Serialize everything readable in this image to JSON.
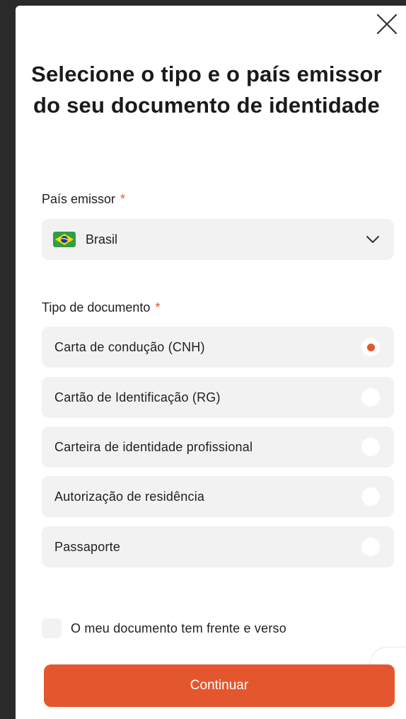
{
  "dialog": {
    "title": "Selecione o tipo e o país emissor do seu documento de identidade"
  },
  "country": {
    "label": "País emissor",
    "required_mark": "*",
    "selected_value": "Brasil",
    "flag_icon": "brazil-flag-icon"
  },
  "document_type": {
    "label": "Tipo de documento",
    "required_mark": "*",
    "options": [
      {
        "label": "Carta de condução (CNH)",
        "selected": true
      },
      {
        "label": "Cartão de Identificação (RG)",
        "selected": false
      },
      {
        "label": "Carteira de identidade profissional",
        "selected": false
      },
      {
        "label": "Autorização de residência",
        "selected": false
      },
      {
        "label": "Passaporte",
        "selected": false
      }
    ]
  },
  "two_sided": {
    "label": "O meu documento tem frente e verso",
    "checked": false
  },
  "actions": {
    "continue_label": "Continuar"
  },
  "colors": {
    "accent": "#e4572e",
    "field_background": "#f2f2f2",
    "text": "#1f1f1f"
  }
}
